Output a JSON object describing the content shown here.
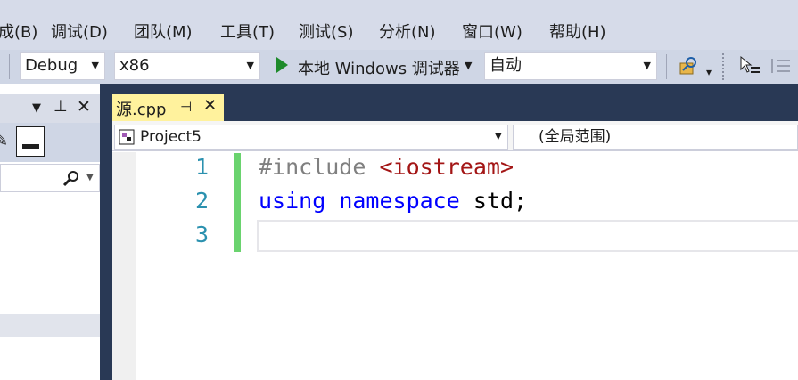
{
  "menu": [
    {
      "label": "生成(B)",
      "visible": "成(B)"
    },
    {
      "label": "调试(D)"
    },
    {
      "label": "团队(M)"
    },
    {
      "label": "工具(T)"
    },
    {
      "label": "测试(S)"
    },
    {
      "label": "分析(N)"
    },
    {
      "label": "窗口(W)"
    },
    {
      "label": "帮助(H)"
    }
  ],
  "toolbar": {
    "config": "Debug",
    "platform": "x86",
    "debugger": "本地 Windows 调试器",
    "mode": "自动"
  },
  "tab": {
    "title": "源.cpp",
    "pin": "⊣",
    "close": "✕"
  },
  "navigation": {
    "project": "Project5",
    "scope": "(全局范围)"
  },
  "editor": {
    "line_numbers": [
      "1",
      "2",
      "3"
    ],
    "line1": {
      "directive": "#include",
      "header": "<iostream>"
    },
    "line2": {
      "kw1": "using",
      "kw2": "namespace",
      "rest": "std;"
    }
  },
  "colors": {
    "keyword": "#0000ff",
    "directive": "#808080",
    "string": "#a31515",
    "linenum": "#2b91af"
  }
}
